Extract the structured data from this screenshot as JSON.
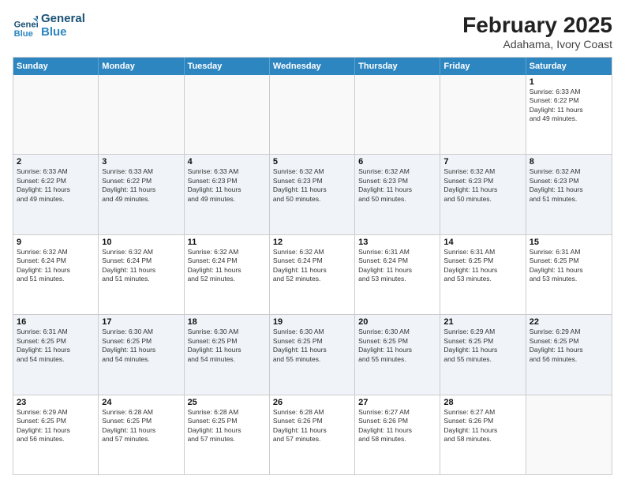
{
  "header": {
    "logo_line1": "General",
    "logo_line2": "Blue",
    "month": "February 2025",
    "location": "Adahama, Ivory Coast"
  },
  "weekdays": [
    "Sunday",
    "Monday",
    "Tuesday",
    "Wednesday",
    "Thursday",
    "Friday",
    "Saturday"
  ],
  "rows": [
    [
      {
        "day": "",
        "info": ""
      },
      {
        "day": "",
        "info": ""
      },
      {
        "day": "",
        "info": ""
      },
      {
        "day": "",
        "info": ""
      },
      {
        "day": "",
        "info": ""
      },
      {
        "day": "",
        "info": ""
      },
      {
        "day": "1",
        "info": "Sunrise: 6:33 AM\nSunset: 6:22 PM\nDaylight: 11 hours\nand 49 minutes."
      }
    ],
    [
      {
        "day": "2",
        "info": "Sunrise: 6:33 AM\nSunset: 6:22 PM\nDaylight: 11 hours\nand 49 minutes."
      },
      {
        "day": "3",
        "info": "Sunrise: 6:33 AM\nSunset: 6:22 PM\nDaylight: 11 hours\nand 49 minutes."
      },
      {
        "day": "4",
        "info": "Sunrise: 6:33 AM\nSunset: 6:23 PM\nDaylight: 11 hours\nand 49 minutes."
      },
      {
        "day": "5",
        "info": "Sunrise: 6:32 AM\nSunset: 6:23 PM\nDaylight: 11 hours\nand 50 minutes."
      },
      {
        "day": "6",
        "info": "Sunrise: 6:32 AM\nSunset: 6:23 PM\nDaylight: 11 hours\nand 50 minutes."
      },
      {
        "day": "7",
        "info": "Sunrise: 6:32 AM\nSunset: 6:23 PM\nDaylight: 11 hours\nand 50 minutes."
      },
      {
        "day": "8",
        "info": "Sunrise: 6:32 AM\nSunset: 6:23 PM\nDaylight: 11 hours\nand 51 minutes."
      }
    ],
    [
      {
        "day": "9",
        "info": "Sunrise: 6:32 AM\nSunset: 6:24 PM\nDaylight: 11 hours\nand 51 minutes."
      },
      {
        "day": "10",
        "info": "Sunrise: 6:32 AM\nSunset: 6:24 PM\nDaylight: 11 hours\nand 51 minutes."
      },
      {
        "day": "11",
        "info": "Sunrise: 6:32 AM\nSunset: 6:24 PM\nDaylight: 11 hours\nand 52 minutes."
      },
      {
        "day": "12",
        "info": "Sunrise: 6:32 AM\nSunset: 6:24 PM\nDaylight: 11 hours\nand 52 minutes."
      },
      {
        "day": "13",
        "info": "Sunrise: 6:31 AM\nSunset: 6:24 PM\nDaylight: 11 hours\nand 53 minutes."
      },
      {
        "day": "14",
        "info": "Sunrise: 6:31 AM\nSunset: 6:25 PM\nDaylight: 11 hours\nand 53 minutes."
      },
      {
        "day": "15",
        "info": "Sunrise: 6:31 AM\nSunset: 6:25 PM\nDaylight: 11 hours\nand 53 minutes."
      }
    ],
    [
      {
        "day": "16",
        "info": "Sunrise: 6:31 AM\nSunset: 6:25 PM\nDaylight: 11 hours\nand 54 minutes."
      },
      {
        "day": "17",
        "info": "Sunrise: 6:30 AM\nSunset: 6:25 PM\nDaylight: 11 hours\nand 54 minutes."
      },
      {
        "day": "18",
        "info": "Sunrise: 6:30 AM\nSunset: 6:25 PM\nDaylight: 11 hours\nand 54 minutes."
      },
      {
        "day": "19",
        "info": "Sunrise: 6:30 AM\nSunset: 6:25 PM\nDaylight: 11 hours\nand 55 minutes."
      },
      {
        "day": "20",
        "info": "Sunrise: 6:30 AM\nSunset: 6:25 PM\nDaylight: 11 hours\nand 55 minutes."
      },
      {
        "day": "21",
        "info": "Sunrise: 6:29 AM\nSunset: 6:25 PM\nDaylight: 11 hours\nand 55 minutes."
      },
      {
        "day": "22",
        "info": "Sunrise: 6:29 AM\nSunset: 6:25 PM\nDaylight: 11 hours\nand 56 minutes."
      }
    ],
    [
      {
        "day": "23",
        "info": "Sunrise: 6:29 AM\nSunset: 6:25 PM\nDaylight: 11 hours\nand 56 minutes."
      },
      {
        "day": "24",
        "info": "Sunrise: 6:28 AM\nSunset: 6:25 PM\nDaylight: 11 hours\nand 57 minutes."
      },
      {
        "day": "25",
        "info": "Sunrise: 6:28 AM\nSunset: 6:25 PM\nDaylight: 11 hours\nand 57 minutes."
      },
      {
        "day": "26",
        "info": "Sunrise: 6:28 AM\nSunset: 6:26 PM\nDaylight: 11 hours\nand 57 minutes."
      },
      {
        "day": "27",
        "info": "Sunrise: 6:27 AM\nSunset: 6:26 PM\nDaylight: 11 hours\nand 58 minutes."
      },
      {
        "day": "28",
        "info": "Sunrise: 6:27 AM\nSunset: 6:26 PM\nDaylight: 11 hours\nand 58 minutes."
      },
      {
        "day": "",
        "info": ""
      }
    ]
  ]
}
